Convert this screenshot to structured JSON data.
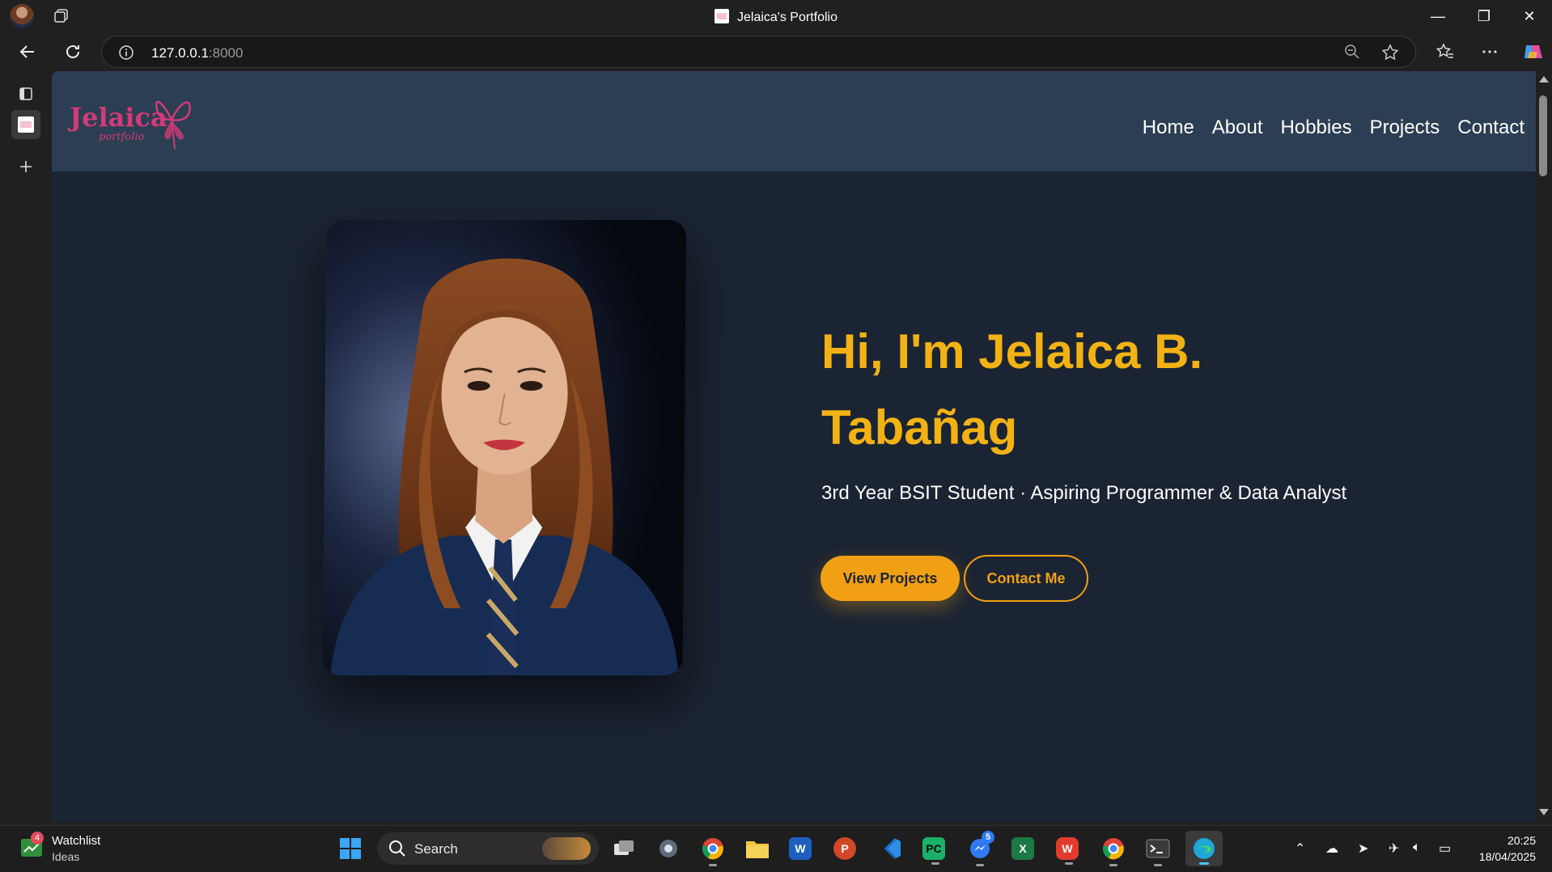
{
  "window": {
    "title": "Jelaica's Portfolio",
    "controls": {
      "minimize": "—",
      "restore": "❐",
      "close": "✕"
    }
  },
  "address_bar": {
    "host": "127.0.0.1",
    "port": ":8000"
  },
  "site": {
    "logo": {
      "name": "Jelaica",
      "tagline": "portfolio",
      "color": "#d13b77"
    },
    "nav": [
      "Home",
      "About",
      "Hobbies",
      "Projects",
      "Contact"
    ],
    "hero": {
      "greeting": "Hi, I'm Jelaica B. Tabañag",
      "subtitle": "3rd Year BSIT Student · Aspiring Programmer & Data Analyst",
      "primary_button": "View Projects",
      "secondary_button": "Contact Me",
      "accent_color": "#f1a014"
    },
    "header_color": "#2c3e53",
    "background_color": "#1b2432"
  },
  "taskbar": {
    "widget": {
      "title": "Watchlist",
      "subtitle": "Ideas",
      "badge": "4"
    },
    "search_label": "Search",
    "messenger_badge": "5",
    "time": "20:25",
    "date": "18/04/2025",
    "apps": [
      "start-icon",
      "file-explorer-icon",
      "settings-icon",
      "chrome-icon",
      "folder-icon",
      "word-icon",
      "powerpoint-icon",
      "vscode-icon",
      "pycharm-icon",
      "messenger-icon",
      "excel-icon",
      "wps-icon",
      "chrome-icon",
      "terminal-icon",
      "edge-icon"
    ]
  }
}
